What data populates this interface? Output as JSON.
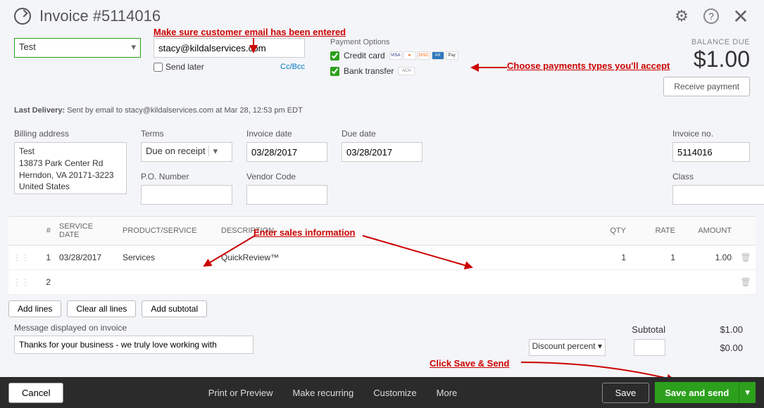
{
  "header": {
    "title": "Invoice #5114016"
  },
  "annotations": {
    "email": "Make sure customer email has been entered",
    "payments": "Choose payments types you'll accept",
    "sales": "Enter sales information",
    "savesend": "Click Save & Send"
  },
  "customer": {
    "name": "Test"
  },
  "email": {
    "value": "stacy@kildalservices.com",
    "send_later": "Send later",
    "ccbcc": "Cc/Bcc"
  },
  "payment": {
    "label": "Payment Options",
    "credit": "Credit card",
    "bank": "Bank transfer",
    "cards": [
      "VISA",
      "MC",
      "DISC",
      "AMEX",
      "Pay"
    ],
    "ach": "ACH"
  },
  "balance": {
    "label": "BALANCE DUE",
    "amount": "$1.00",
    "receive": "Receive payment"
  },
  "delivery": {
    "prefix": "Last Delivery:",
    "text": " Sent by email to stacy@kildalservices.com at Mar 28, 12:53 pm EDT"
  },
  "fields": {
    "billing_label": "Billing address",
    "billing_value": "Test\n13873 Park Center Rd\nHerndon, VA  20171-3223\nUnited States",
    "terms_label": "Terms",
    "terms_value": "Due on receipt",
    "invdate_label": "Invoice date",
    "invdate_value": "03/28/2017",
    "duedate_label": "Due date",
    "duedate_value": "03/28/2017",
    "invno_label": "Invoice no.",
    "invno_value": "5114016",
    "po_label": "P.O. Number",
    "po_value": "",
    "vendor_label": "Vendor Code",
    "vendor_value": "",
    "class_label": "Class",
    "class_value": ""
  },
  "table": {
    "headers": {
      "num": "#",
      "service_date": "SERVICE DATE",
      "product": "PRODUCT/SERVICE",
      "desc": "DESCRIPTION",
      "qty": "QTY",
      "rate": "RATE",
      "amount": "AMOUNT"
    },
    "rows": [
      {
        "num": "1",
        "service_date": "03/28/2017",
        "product": "Services",
        "desc": "QuickReview™",
        "qty": "1",
        "rate": "1",
        "amount": "1.00"
      },
      {
        "num": "2",
        "service_date": "",
        "product": "",
        "desc": "",
        "qty": "",
        "rate": "",
        "amount": ""
      }
    ],
    "buttons": {
      "add_lines": "Add lines",
      "clear": "Clear all lines",
      "subtotal": "Add subtotal"
    }
  },
  "totals": {
    "subtotal_label": "Subtotal",
    "subtotal_value": "$1.00",
    "discount_label": "Discount percent",
    "discount_value": "$0.00"
  },
  "message": {
    "label": "Message displayed on invoice",
    "value": "Thanks for your business - we truly love working with"
  },
  "bottom": {
    "cancel": "Cancel",
    "print": "Print or Preview",
    "recurring": "Make recurring",
    "customize": "Customize",
    "more": "More",
    "save": "Save",
    "save_send": "Save and send"
  }
}
